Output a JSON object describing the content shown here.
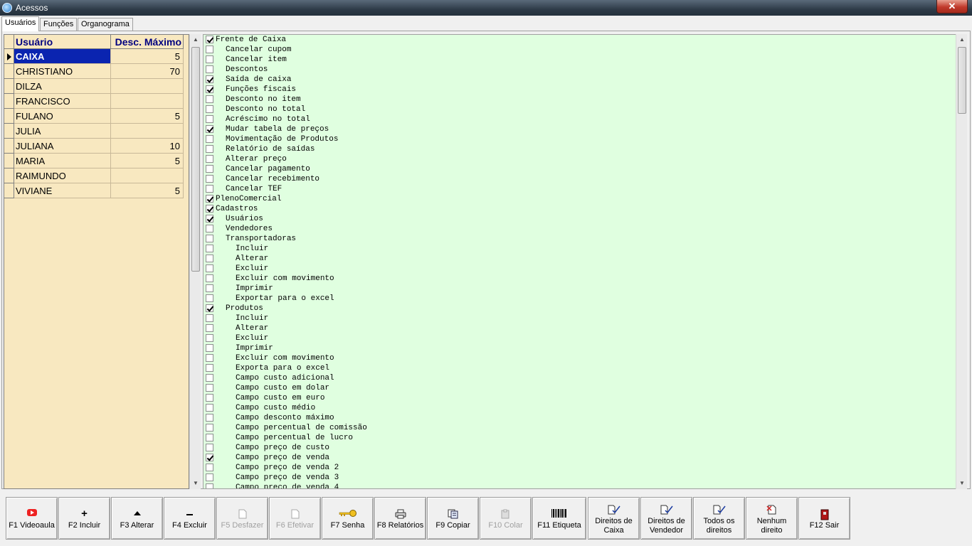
{
  "window": {
    "title": "Acessos",
    "close_label": "✕"
  },
  "tabs": [
    {
      "label": "Usuários",
      "active": true
    },
    {
      "label": "Funções",
      "active": false
    },
    {
      "label": "Organograma",
      "active": false
    }
  ],
  "grid": {
    "headers": {
      "user": "Usuário",
      "desc": "Desc. Máximo"
    },
    "rows": [
      {
        "user": "CAIXA",
        "desc": "5"
      },
      {
        "user": "CHRISTIANO",
        "desc": "70"
      },
      {
        "user": "DILZA",
        "desc": ""
      },
      {
        "user": "FRANCISCO",
        "desc": ""
      },
      {
        "user": "FULANO",
        "desc": "5"
      },
      {
        "user": "JULIA",
        "desc": ""
      },
      {
        "user": "JULIANA",
        "desc": "10"
      },
      {
        "user": "MARIA",
        "desc": "5"
      },
      {
        "user": "RAIMUNDO",
        "desc": ""
      },
      {
        "user": "VIVIANE",
        "desc": "5"
      }
    ],
    "selected_row": 0
  },
  "tree": [
    {
      "label": "Frente de Caixa",
      "level": 0,
      "checked": true
    },
    {
      "label": "Cancelar cupom",
      "level": 1,
      "checked": false
    },
    {
      "label": "Cancelar item",
      "level": 1,
      "checked": false
    },
    {
      "label": "Descontos",
      "level": 1,
      "checked": false
    },
    {
      "label": "Saída de caixa",
      "level": 1,
      "checked": true
    },
    {
      "label": "Funções fiscais",
      "level": 1,
      "checked": true
    },
    {
      "label": "Desconto no item",
      "level": 1,
      "checked": false
    },
    {
      "label": "Desconto no total",
      "level": 1,
      "checked": false
    },
    {
      "label": "Acréscimo no total",
      "level": 1,
      "checked": false
    },
    {
      "label": "Mudar tabela de preços",
      "level": 1,
      "checked": true
    },
    {
      "label": "Movimentação de Produtos",
      "level": 1,
      "checked": false
    },
    {
      "label": "Relatório de saídas",
      "level": 1,
      "checked": false
    },
    {
      "label": "Alterar preço",
      "level": 1,
      "checked": false
    },
    {
      "label": "Cancelar pagamento",
      "level": 1,
      "checked": false
    },
    {
      "label": "Cancelar recebimento",
      "level": 1,
      "checked": false
    },
    {
      "label": "Cancelar TEF",
      "level": 1,
      "checked": false
    },
    {
      "label": "PlenoComercial",
      "level": 0,
      "checked": true
    },
    {
      "label": "Cadastros",
      "level": 0,
      "checked": true
    },
    {
      "label": "Usuários",
      "level": 1,
      "checked": true
    },
    {
      "label": "Vendedores",
      "level": 1,
      "checked": false
    },
    {
      "label": "Transportadoras",
      "level": 1,
      "checked": false
    },
    {
      "label": "Incluir",
      "level": 2,
      "checked": false
    },
    {
      "label": "Alterar",
      "level": 2,
      "checked": false
    },
    {
      "label": "Excluir",
      "level": 2,
      "checked": false
    },
    {
      "label": "Excluir com movimento",
      "level": 2,
      "checked": false
    },
    {
      "label": "Imprimir",
      "level": 2,
      "checked": false
    },
    {
      "label": "Exportar para o excel",
      "level": 2,
      "checked": false
    },
    {
      "label": "Produtos",
      "level": 1,
      "checked": true
    },
    {
      "label": "Incluir",
      "level": 2,
      "checked": false
    },
    {
      "label": "Alterar",
      "level": 2,
      "checked": false
    },
    {
      "label": "Excluir",
      "level": 2,
      "checked": false
    },
    {
      "label": "Imprimir",
      "level": 2,
      "checked": false
    },
    {
      "label": "Excluir com movimento",
      "level": 2,
      "checked": false
    },
    {
      "label": "Exporta para o excel",
      "level": 2,
      "checked": false
    },
    {
      "label": "Campo custo adicional",
      "level": 2,
      "checked": false
    },
    {
      "label": "Campo custo em dolar",
      "level": 2,
      "checked": false
    },
    {
      "label": "Campo custo em euro",
      "level": 2,
      "checked": false
    },
    {
      "label": "Campo custo médio",
      "level": 2,
      "checked": false
    },
    {
      "label": "Campo desconto máximo",
      "level": 2,
      "checked": false
    },
    {
      "label": "Campo percentual de comissão",
      "level": 2,
      "checked": false
    },
    {
      "label": "Campo percentual de lucro",
      "level": 2,
      "checked": false
    },
    {
      "label": "Campo preço de custo",
      "level": 2,
      "checked": false
    },
    {
      "label": "Campo preço de venda",
      "level": 2,
      "checked": true
    },
    {
      "label": "Campo preço de venda 2",
      "level": 2,
      "checked": false
    },
    {
      "label": "Campo preço de venda 3",
      "level": 2,
      "checked": false
    },
    {
      "label": "Campo preço de venda 4",
      "level": 2,
      "checked": false
    }
  ],
  "toolbar": [
    {
      "label": "F1 Videoaula",
      "icon": "youtube-icon",
      "enabled": true
    },
    {
      "label": "F2 Incluir",
      "icon": "plus-icon",
      "enabled": true
    },
    {
      "label": "F3 Alterar",
      "icon": "up-triangle-icon",
      "enabled": true
    },
    {
      "label": "F4 Excluir",
      "icon": "minus-icon",
      "enabled": true
    },
    {
      "label": "F5 Desfazer",
      "icon": "document-icon",
      "enabled": false
    },
    {
      "label": "F6 Efetivar",
      "icon": "document-icon",
      "enabled": false
    },
    {
      "label": "F7 Senha",
      "icon": "key-icon",
      "enabled": true
    },
    {
      "label": "F8 Relatórios",
      "icon": "printer-icon",
      "enabled": true
    },
    {
      "label": "F9 Copiar",
      "icon": "copy-icon",
      "enabled": true
    },
    {
      "label": "F10 Colar",
      "icon": "paste-icon",
      "enabled": false
    },
    {
      "label": "F11 Etiqueta",
      "icon": "barcode-icon",
      "enabled": true
    },
    {
      "label": "Direitos de\nCaixa",
      "icon": "check-document-icon",
      "enabled": true
    },
    {
      "label": "Direitos de\nVendedor",
      "icon": "check-document-icon",
      "enabled": true
    },
    {
      "label": "Todos os\ndireitos",
      "icon": "check-document-icon",
      "enabled": true
    },
    {
      "label": "Nenhum\ndireito",
      "icon": "x-document-icon",
      "enabled": true
    },
    {
      "label": "F12 Sair",
      "icon": "exit-door-icon",
      "enabled": true
    }
  ]
}
